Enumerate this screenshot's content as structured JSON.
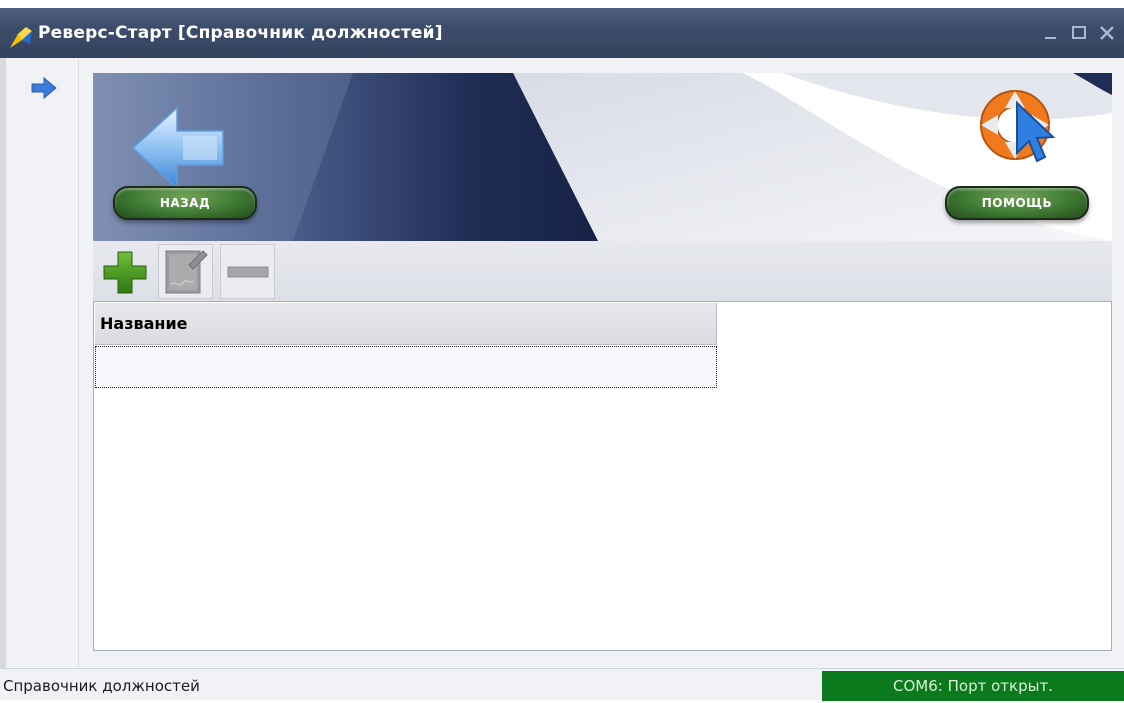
{
  "window": {
    "title": "Реверс-Старт  [Справочник должностей]",
    "controls": [
      "minimize-icon",
      "maximize-icon",
      "close-icon"
    ]
  },
  "banner": {
    "back_label": "НАЗАД",
    "help_label": "ПОМОЩЬ"
  },
  "toolbar": {
    "buttons": [
      "plus-icon",
      "edit-icon",
      "minus-icon"
    ]
  },
  "grid": {
    "columns": [
      "Название"
    ],
    "rows": []
  },
  "status": {
    "left": "Справочник должностей",
    "right": "COM6: Порт открыт.",
    "port_color": "#0b7a1c"
  },
  "colors": {
    "title_bar": "#3c4d6b",
    "button_green": "#3e7a33",
    "banner_navy": "#1f2d55"
  }
}
